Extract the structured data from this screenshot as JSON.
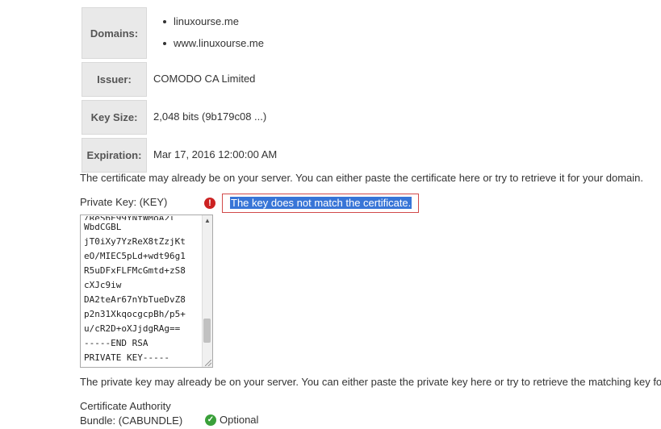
{
  "cert": {
    "domains_label": "Domains:",
    "domains": [
      "linuxourse.me",
      "www.linuxourse.me"
    ],
    "issuer_label": "Issuer:",
    "issuer": "COMODO CA Limited",
    "keysize_label": "Key Size:",
    "keysize": "2,048 bits (9b179c08 ...)",
    "expiration_label": "Expiration:",
    "expiration": "Mar 17, 2016 12:00:00 AM"
  },
  "notes": {
    "certificate": "The certificate may already be on your server. You can either paste the certificate here or try to retrieve it for your domain.",
    "private_key": "The private key may already be on your server. You can either paste the private key here or try to retrieve the matching key fo"
  },
  "private_key": {
    "label": "Private Key: (KEY)",
    "error_message": "The key does not match the certificate.",
    "lines": [
      "WbdCGBL",
      "jT0iXy7YzReX8tZzjKt",
      "eO/MIEC5pLd+wdt96g1",
      "R5uDFxFLFMcGmtd+zS8",
      "cXJc9iw",
      "DA2teAr67nYbTueDvZ8",
      "p2n31XkqocgcpBh/p5+",
      "u/cR2D+oXJjdgRAg==",
      "-----END RSA",
      "PRIVATE KEY-----"
    ]
  },
  "ca_bundle": {
    "label_line1": "Certificate Authority",
    "label_line2": "Bundle: (CABUNDLE)",
    "status": "Optional"
  },
  "icons": {
    "error": "error-icon",
    "ok": "check-circle-icon"
  },
  "colors": {
    "error_border": "#d24a4a",
    "selection": "#3875d7",
    "ok": "#3aa03a"
  }
}
